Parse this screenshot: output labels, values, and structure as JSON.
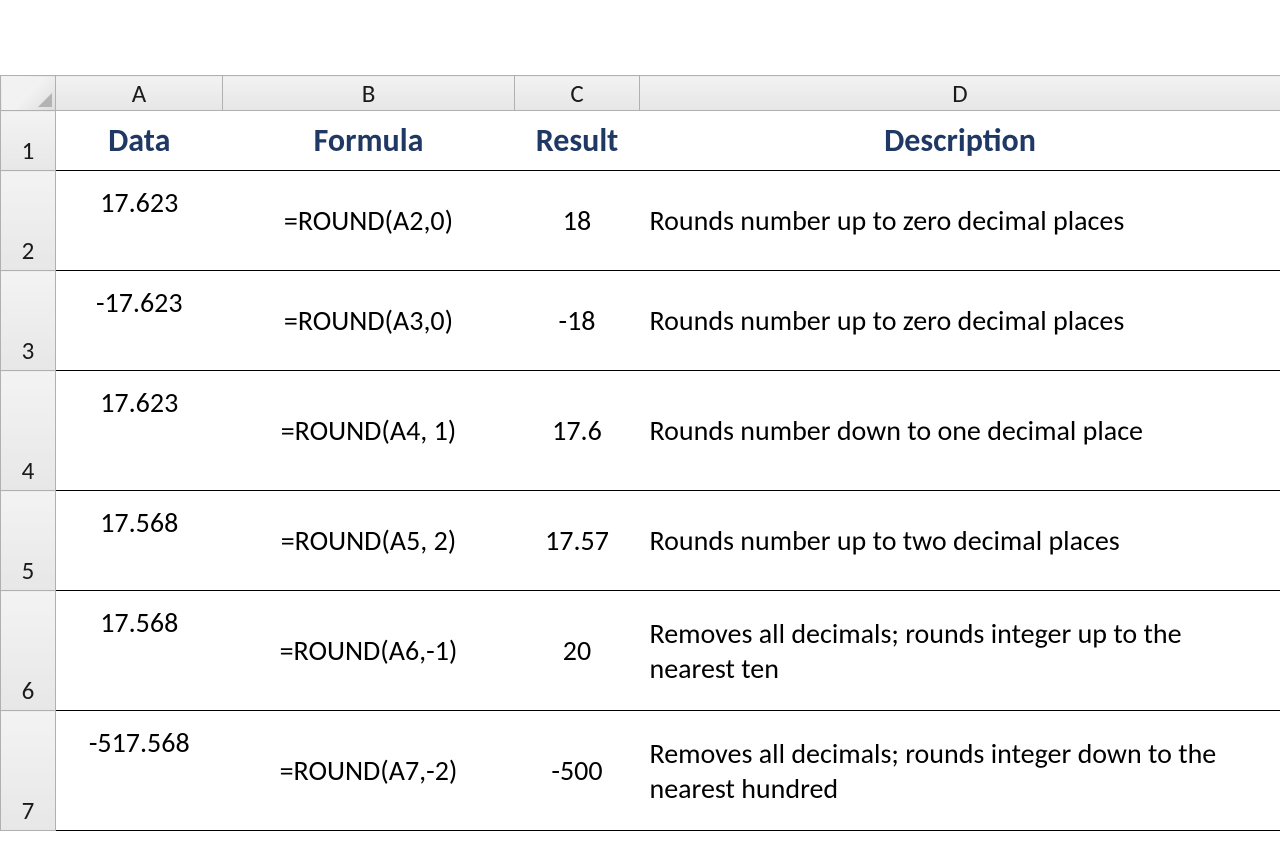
{
  "columns": {
    "A": "A",
    "B": "B",
    "C": "C",
    "D": "D"
  },
  "row_numbers": [
    "1",
    "2",
    "3",
    "4",
    "5",
    "6",
    "7"
  ],
  "headers": {
    "data": "Data",
    "formula": "Formula",
    "result": "Result",
    "description": "Description"
  },
  "rows": [
    {
      "data": "17.623",
      "formula": "=ROUND(A2,0)",
      "result": "18",
      "description": "Rounds number up to zero decimal places"
    },
    {
      "data": "-17.623",
      "formula": "=ROUND(A3,0)",
      "result": "-18",
      "description": "Rounds number up to zero decimal places"
    },
    {
      "data": "17.623",
      "formula": "=ROUND(A4, 1)",
      "result": "17.6",
      "description": "Rounds number down to one decimal place"
    },
    {
      "data": "17.568",
      "formula": "=ROUND(A5, 2)",
      "result": "17.57",
      "description": "Rounds number up to two decimal places"
    },
    {
      "data": "17.568",
      "formula": "=ROUND(A6,-1)",
      "result": "20",
      "description": "Removes all decimals; rounds integer up to the nearest ten"
    },
    {
      "data": "-517.568",
      "formula": "=ROUND(A7,-2)",
      "result": "-500",
      "description": "Removes all decimals; rounds integer down to the nearest hundred"
    }
  ]
}
